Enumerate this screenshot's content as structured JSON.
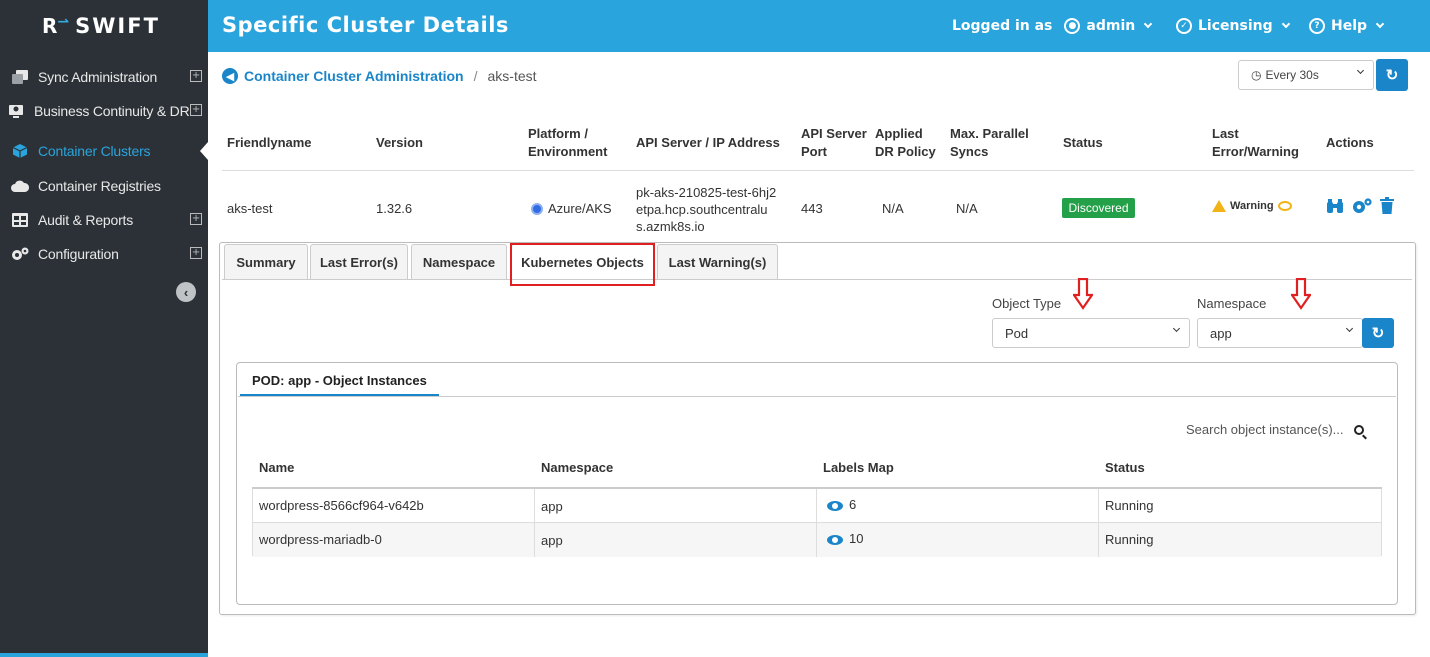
{
  "sidebar": {
    "logo_mark": "R",
    "logo_text": "SWIFT",
    "items": [
      {
        "label": "Sync Administration",
        "expandable": true,
        "icon": "copy-icon"
      },
      {
        "label": "Business Continuity & DR",
        "expandable": true,
        "icon": "monitor-user-icon"
      },
      {
        "label": "Container Clusters",
        "expandable": false,
        "active": true,
        "icon": "cube-icon"
      },
      {
        "label": "Container Registries",
        "expandable": false,
        "icon": "cloud-icon"
      },
      {
        "label": "Audit & Reports",
        "expandable": true,
        "icon": "table-icon"
      },
      {
        "label": "Configuration",
        "expandable": true,
        "icon": "gears-icon"
      }
    ],
    "expand_symbol": "⊞",
    "collapse_symbol": "←"
  },
  "header": {
    "title": "Specific Cluster Details",
    "logged_in_as": "Logged in as",
    "user": "admin",
    "licensing": "Licensing",
    "help": "Help"
  },
  "breadcrumb": {
    "parent": "Container Cluster Administration",
    "separator": "/",
    "current": "aks-test"
  },
  "refresh": {
    "interval": "Every 30s",
    "button": "↻"
  },
  "cluster_table": {
    "headers": {
      "friendlyname": "Friendlyname",
      "version": "Version",
      "platform_1": "Platform /",
      "platform_2": "Environment",
      "api": "API Server / IP Address",
      "port_1": "API Server",
      "port_2": "Port",
      "policy_1": "Applied",
      "policy_2": "DR Policy",
      "syncs_1": "Max. Parallel",
      "syncs_2": "Syncs",
      "status": "Status",
      "error_1": "Last",
      "error_2": "Error/Warning",
      "actions": "Actions"
    },
    "row": {
      "friendlyname": "aks-test",
      "version": "1.32.6",
      "platform": "Azure/AKS",
      "api_1": "pk-aks-210825-test-6hj2",
      "api_2": "etpa.hcp.southcentralu",
      "api_3": "s.azmk8s.io",
      "port": "443",
      "policy": "N/A",
      "syncs": "N/A",
      "status": "Discovered",
      "warning": "Warning"
    }
  },
  "tabs": [
    "Summary",
    "Last Error(s)",
    "Namespace",
    "Kubernetes Objects",
    "Last Warning(s)"
  ],
  "filters": {
    "object_type_label": "Object Type",
    "object_type_value": "Pod",
    "namespace_label": "Namespace",
    "namespace_value": "app"
  },
  "instances": {
    "tab_label": "POD: app - Object Instances",
    "search_placeholder": "Search object instance(s)...",
    "headers": [
      "Name",
      "Namespace",
      "Labels Map",
      "Status"
    ],
    "rows": [
      {
        "name": "wordpress-8566cf964-v642b",
        "namespace": "app",
        "labels": "6",
        "status": "Running"
      },
      {
        "name": "wordpress-mariadb-0",
        "namespace": "app",
        "labels": "10",
        "status": "Running"
      }
    ]
  },
  "colors": {
    "accent": "#2aa4dc",
    "sidebar_bg": "#2b3136",
    "status_discovered": "#24a148",
    "warning": "#f2b316",
    "highlight": "#e02020"
  }
}
